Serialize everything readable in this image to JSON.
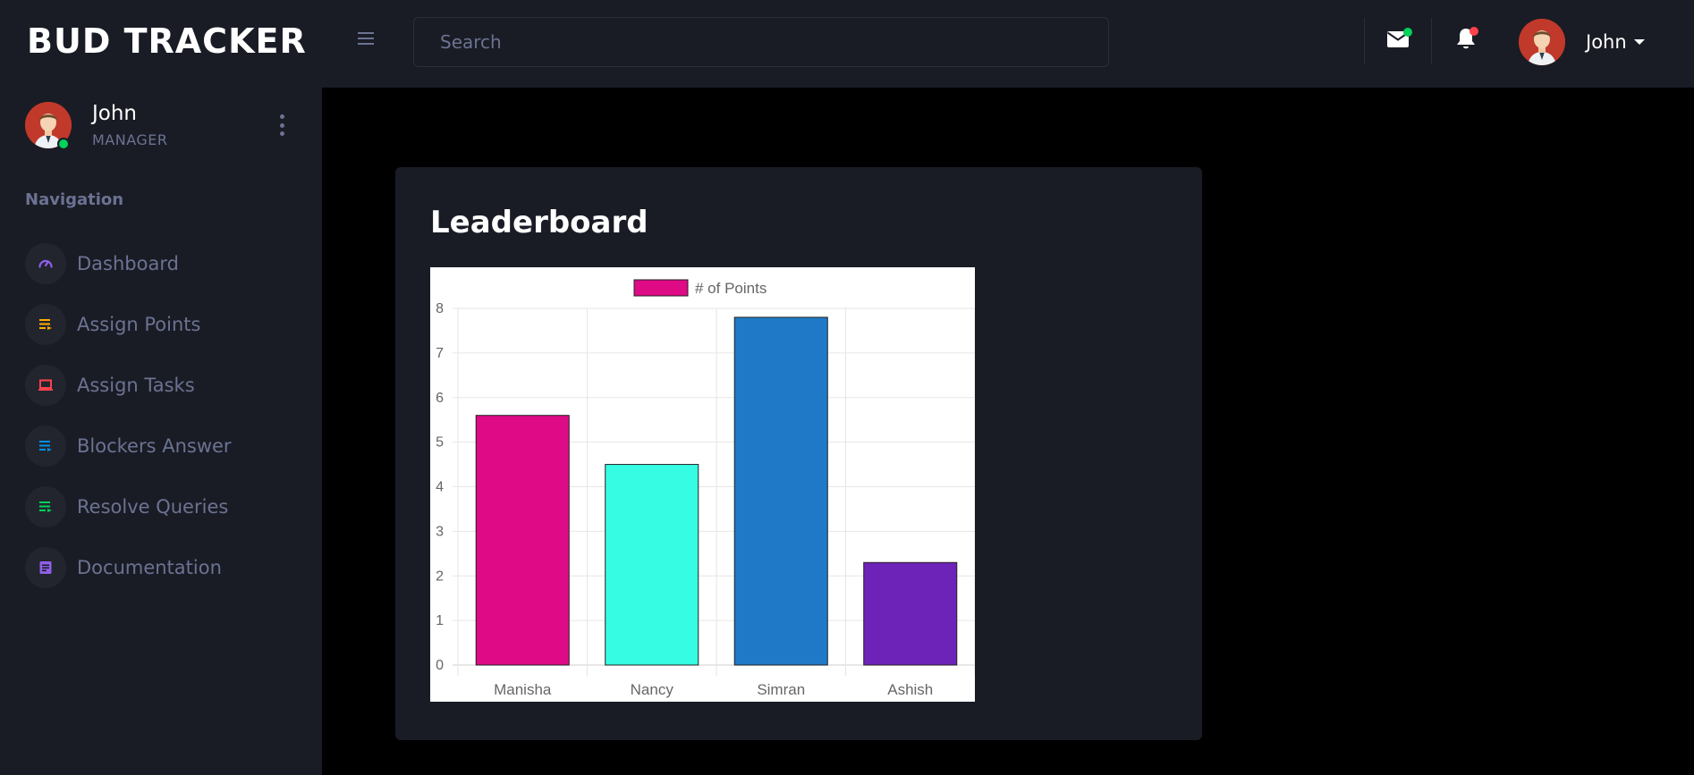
{
  "app": {
    "brand": "BUD TRACKER"
  },
  "sidebar": {
    "user": {
      "name": "John",
      "role": "MANAGER"
    },
    "nav_heading": "Navigation",
    "items": [
      {
        "label": "Dashboard",
        "icon": "speedometer-icon",
        "color": "#8f5fe8"
      },
      {
        "label": "Assign Points",
        "icon": "playlist-play-icon",
        "color": "#ffab00"
      },
      {
        "label": "Assign Tasks",
        "icon": "laptop-icon",
        "color": "#fc424a"
      },
      {
        "label": "Blockers Answer",
        "icon": "playlist-play-icon",
        "color": "#0090e7"
      },
      {
        "label": "Resolve Queries",
        "icon": "playlist-play-icon",
        "color": "#00d25b"
      },
      {
        "label": "Documentation",
        "icon": "file-document-icon",
        "color": "#8f5fe8"
      }
    ]
  },
  "topbar": {
    "search_placeholder": "Search",
    "user_name": "John",
    "mail_badge_color": "#00d25b",
    "bell_badge_color": "#fc424a"
  },
  "card": {
    "title": "Leaderboard"
  },
  "chart_data": {
    "type": "bar",
    "categories": [
      "Manisha",
      "Nancy",
      "Simran",
      "Ashish"
    ],
    "series": [
      {
        "name": "# of Points",
        "values": [
          5.6,
          4.5,
          7.8,
          2.3
        ]
      }
    ],
    "bar_colors": [
      "#de0a86",
      "#36fce4",
      "#1f79c6",
      "#6d22b8"
    ],
    "legend_color": "#de0a86",
    "legend_position": "top",
    "ylim": [
      0,
      8
    ],
    "yticks": [
      0,
      1,
      2,
      3,
      4,
      5,
      6,
      7,
      8
    ],
    "grid": true,
    "title": "",
    "xlabel": "",
    "ylabel": ""
  }
}
